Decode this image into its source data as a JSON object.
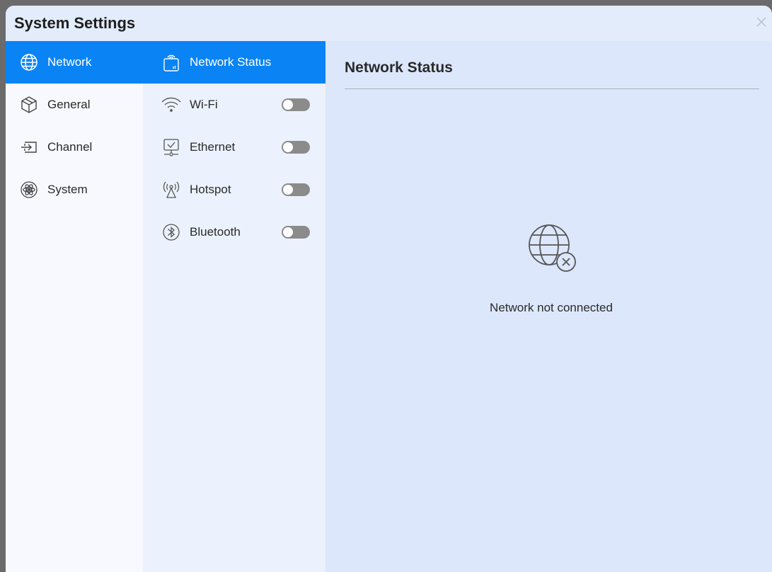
{
  "window": {
    "title": "System Settings"
  },
  "sidebar": {
    "items": [
      {
        "label": "Network",
        "icon": "globe-icon",
        "active": true
      },
      {
        "label": "General",
        "icon": "cube-icon",
        "active": false
      },
      {
        "label": "Channel",
        "icon": "input-icon",
        "active": false
      },
      {
        "label": "System",
        "icon": "atom-icon",
        "active": false
      }
    ]
  },
  "subnav": {
    "items": [
      {
        "label": "Network Status",
        "icon": "router-icon",
        "active": true
      },
      {
        "label": "Wi-Fi",
        "icon": "wifi-icon",
        "toggle_on": false
      },
      {
        "label": "Ethernet",
        "icon": "ethernet-icon",
        "toggle_on": false
      },
      {
        "label": "Hotspot",
        "icon": "hotspot-icon",
        "toggle_on": false
      },
      {
        "label": "Bluetooth",
        "icon": "bluetooth-icon",
        "toggle_on": false
      }
    ]
  },
  "content": {
    "title": "Network Status",
    "status_icon": "globe-disconnected-icon",
    "status_text": "Network not connected"
  },
  "colors": {
    "accent": "#0a84f5",
    "toggle_off": "#8b8b8b"
  }
}
